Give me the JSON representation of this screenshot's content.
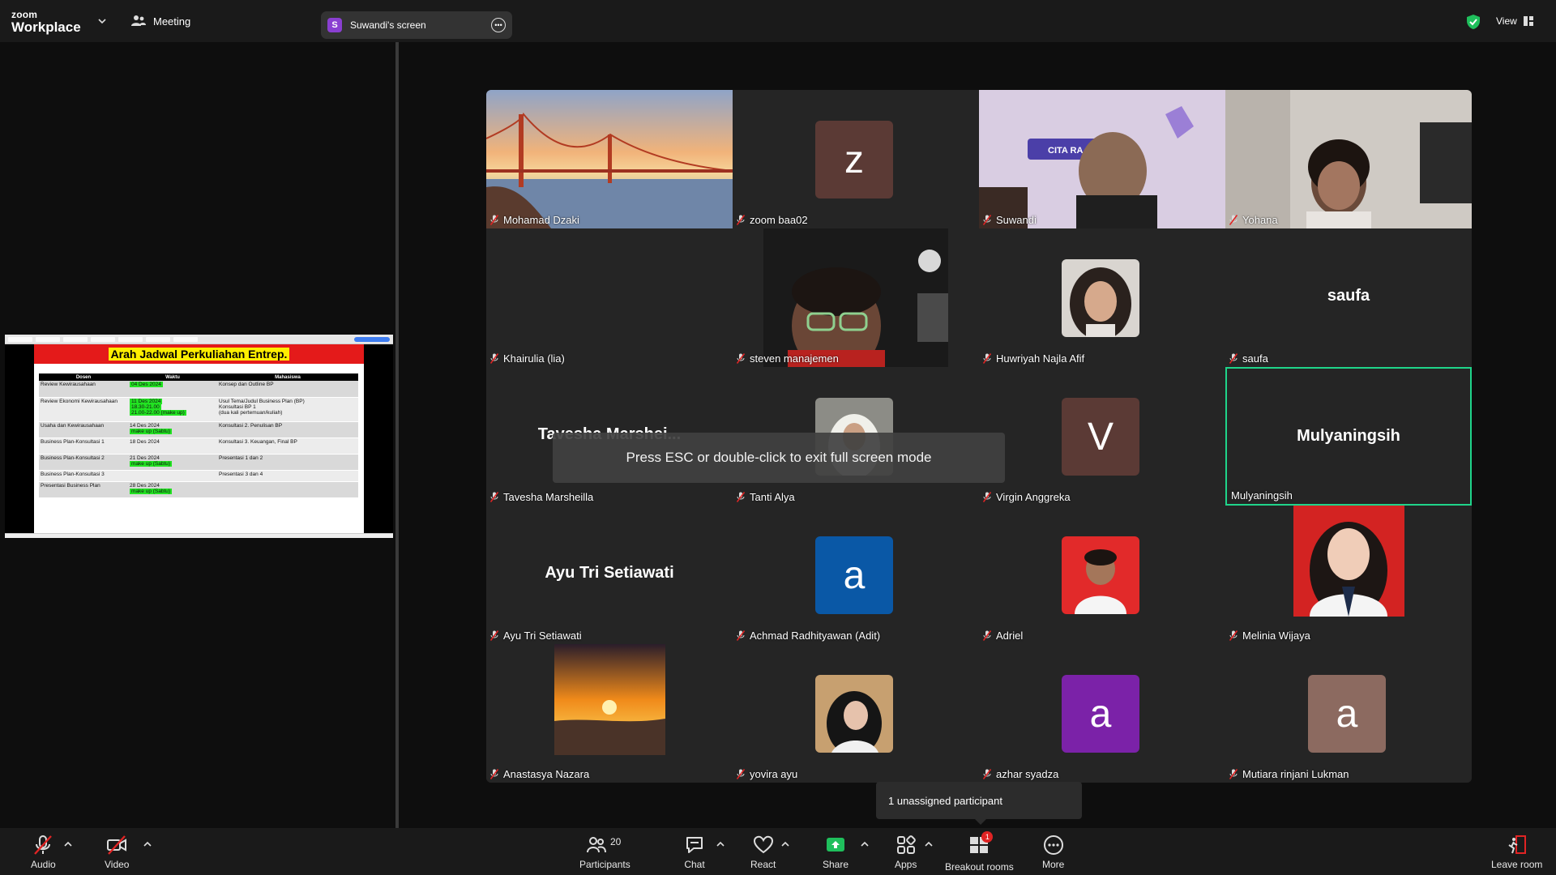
{
  "topbar": {
    "brand_small": "zoom",
    "brand_big": "Workplace",
    "meeting_label": "Meeting",
    "share_pill_initial": "S",
    "share_pill_label": "Suwandi's screen",
    "view_label": "View",
    "colors": {
      "secure": "#1fbf5c",
      "pill_avatar": "#8a3fd1"
    }
  },
  "shared_screen": {
    "title": "Arah Jadwal Perkuliahan Entrep.",
    "columns": [
      "Dosen",
      "Waktu",
      "Mahasiswa"
    ],
    "rows": [
      {
        "dosen": "Review Kewirausahaan",
        "waktu": [
          "04 Des 2024"
        ],
        "mahasiswa": [
          "Konsep dan Outline BP"
        ]
      },
      {
        "dosen": "Review Ekonomi Kewirausahaan",
        "waktu": [
          "11 Des 2024",
          "18.30-21.00",
          "21.00-22.00 (make up)"
        ],
        "mahasiswa": [
          "Usul Tema/Judul Business Plan (BP)",
          "Konsultasi BP 1",
          "(dua kali pertemuan/kuliah)"
        ]
      },
      {
        "dosen": "Usaha dan Kewirausahaan",
        "waktu": [
          "14 Des 2024",
          "make up (Sabtu)"
        ],
        "mahasiswa": [
          "Konsultasi 2. Penulisan BP"
        ]
      },
      {
        "dosen": "Business Plan-Konsultasi 1",
        "waktu": [
          "18 Des  2024"
        ],
        "mahasiswa": [
          "Konsultasi 3. Keuangan, Final BP"
        ]
      },
      {
        "dosen": "Business Plan-Konsultasi 2",
        "waktu": [
          "21 Des 2024",
          "make up (Sabtu)"
        ],
        "mahasiswa": [
          "Presentasi  1 dan 2"
        ]
      },
      {
        "dosen": "Business Plan-Konsultasi  3",
        "waktu": [
          ""
        ],
        "mahasiswa": [
          "Presentasi 3 dan 4"
        ]
      },
      {
        "dosen": "Presentasi Business Plan",
        "waktu": [
          "28 Des 2024",
          "make up (Sabtu)"
        ],
        "mahasiswa": [
          ""
        ]
      }
    ]
  },
  "participants": [
    {
      "name": "Mohamad Dzaki",
      "kind": "bridge"
    },
    {
      "name": "zoom baa02",
      "kind": "avatar",
      "initial": "z",
      "color": "#5b3a35"
    },
    {
      "name": "Suwandi",
      "kind": "video-suwandi",
      "video_text": "CITA RA... NIS YA..."
    },
    {
      "name": "Yohana",
      "kind": "video-yohana"
    },
    {
      "name": "Khairulia (lia)",
      "kind": "blank"
    },
    {
      "name": "steven manajemen",
      "kind": "video-steven"
    },
    {
      "name": "Huwriyah Najla Afif",
      "kind": "photo-girl"
    },
    {
      "name": "saufa",
      "kind": "nameonly",
      "display": "saufa"
    },
    {
      "name": "Tavesha Marsheilla",
      "kind": "nameonly",
      "display": "Tavesha  Marshei..."
    },
    {
      "name": "Tanti Alya",
      "kind": "photo-hijab"
    },
    {
      "name": "Virgin Anggreka",
      "kind": "avatar",
      "initial": "V",
      "color": "#5b3a35"
    },
    {
      "name": "Mulyaningsih",
      "kind": "nameonly",
      "display": "Mulyaningsih",
      "active": true,
      "muted": false
    },
    {
      "name": "Ayu Tri Setiawati",
      "kind": "nameonly",
      "display": "Ayu Tri Setiawati"
    },
    {
      "name": "Achmad Radhityawan (Adit)",
      "kind": "avatar",
      "initial": "a",
      "color": "#0a58a6"
    },
    {
      "name": "Adriel",
      "kind": "photo-adriel"
    },
    {
      "name": "Melinia Wijaya",
      "kind": "photo-melinia"
    },
    {
      "name": "Anastasya Nazara",
      "kind": "photo-sunset"
    },
    {
      "name": "yovira ayu",
      "kind": "photo-yovira"
    },
    {
      "name": "azhar syadza",
      "kind": "avatar",
      "initial": "a",
      "color": "#7b22a8"
    },
    {
      "name": "Mutiara rinjani Lukman",
      "kind": "avatar",
      "initial": "a",
      "color": "#8c6a60"
    }
  ],
  "toast": "Press ESC or double-click to exit full screen mode",
  "unassigned": "1 unassigned participant",
  "toolbar": {
    "audio": "Audio",
    "video": "Video",
    "participants": "Participants",
    "participants_count": "20",
    "chat": "Chat",
    "react": "React",
    "share": "Share",
    "apps": "Apps",
    "breakout": "Breakout rooms",
    "breakout_badge": "1",
    "more": "More",
    "leave": "Leave room",
    "colors": {
      "muted": "#e02424",
      "share": "#1fbf5c",
      "leave": "#e02424"
    }
  }
}
